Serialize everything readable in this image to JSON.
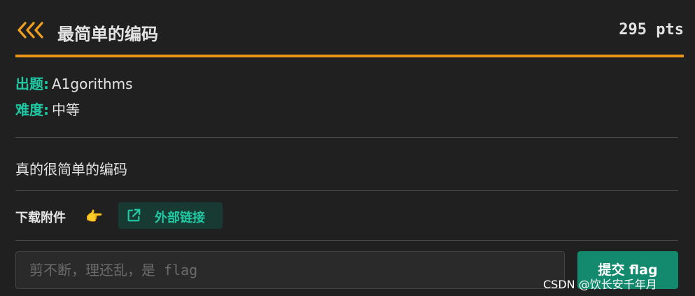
{
  "challenge": {
    "title": "最简单的编码",
    "points": "295 pts",
    "author_label": "出题:",
    "author": "A1gorithms",
    "difficulty_label": "难度:",
    "difficulty": "中等",
    "description": "真的很简单的编码",
    "attachments_label": "下载附件",
    "attachment_pointer": "👉",
    "external_link_label": "外部链接"
  },
  "flag_form": {
    "value": "",
    "placeholder": "剪不断，理还乱，是 flag",
    "submit_label": "提交 flag"
  },
  "watermark": "CSDN @饮长安千年月",
  "icons": {
    "header": "triple-chevron-left-icon",
    "pointer": "pointing-hand-icon",
    "external": "external-link-icon"
  },
  "colors": {
    "accent_orange": "#ea9213",
    "accent_teal": "#1fc7a2",
    "submit_bg": "#138a6d",
    "background": "#202020"
  }
}
